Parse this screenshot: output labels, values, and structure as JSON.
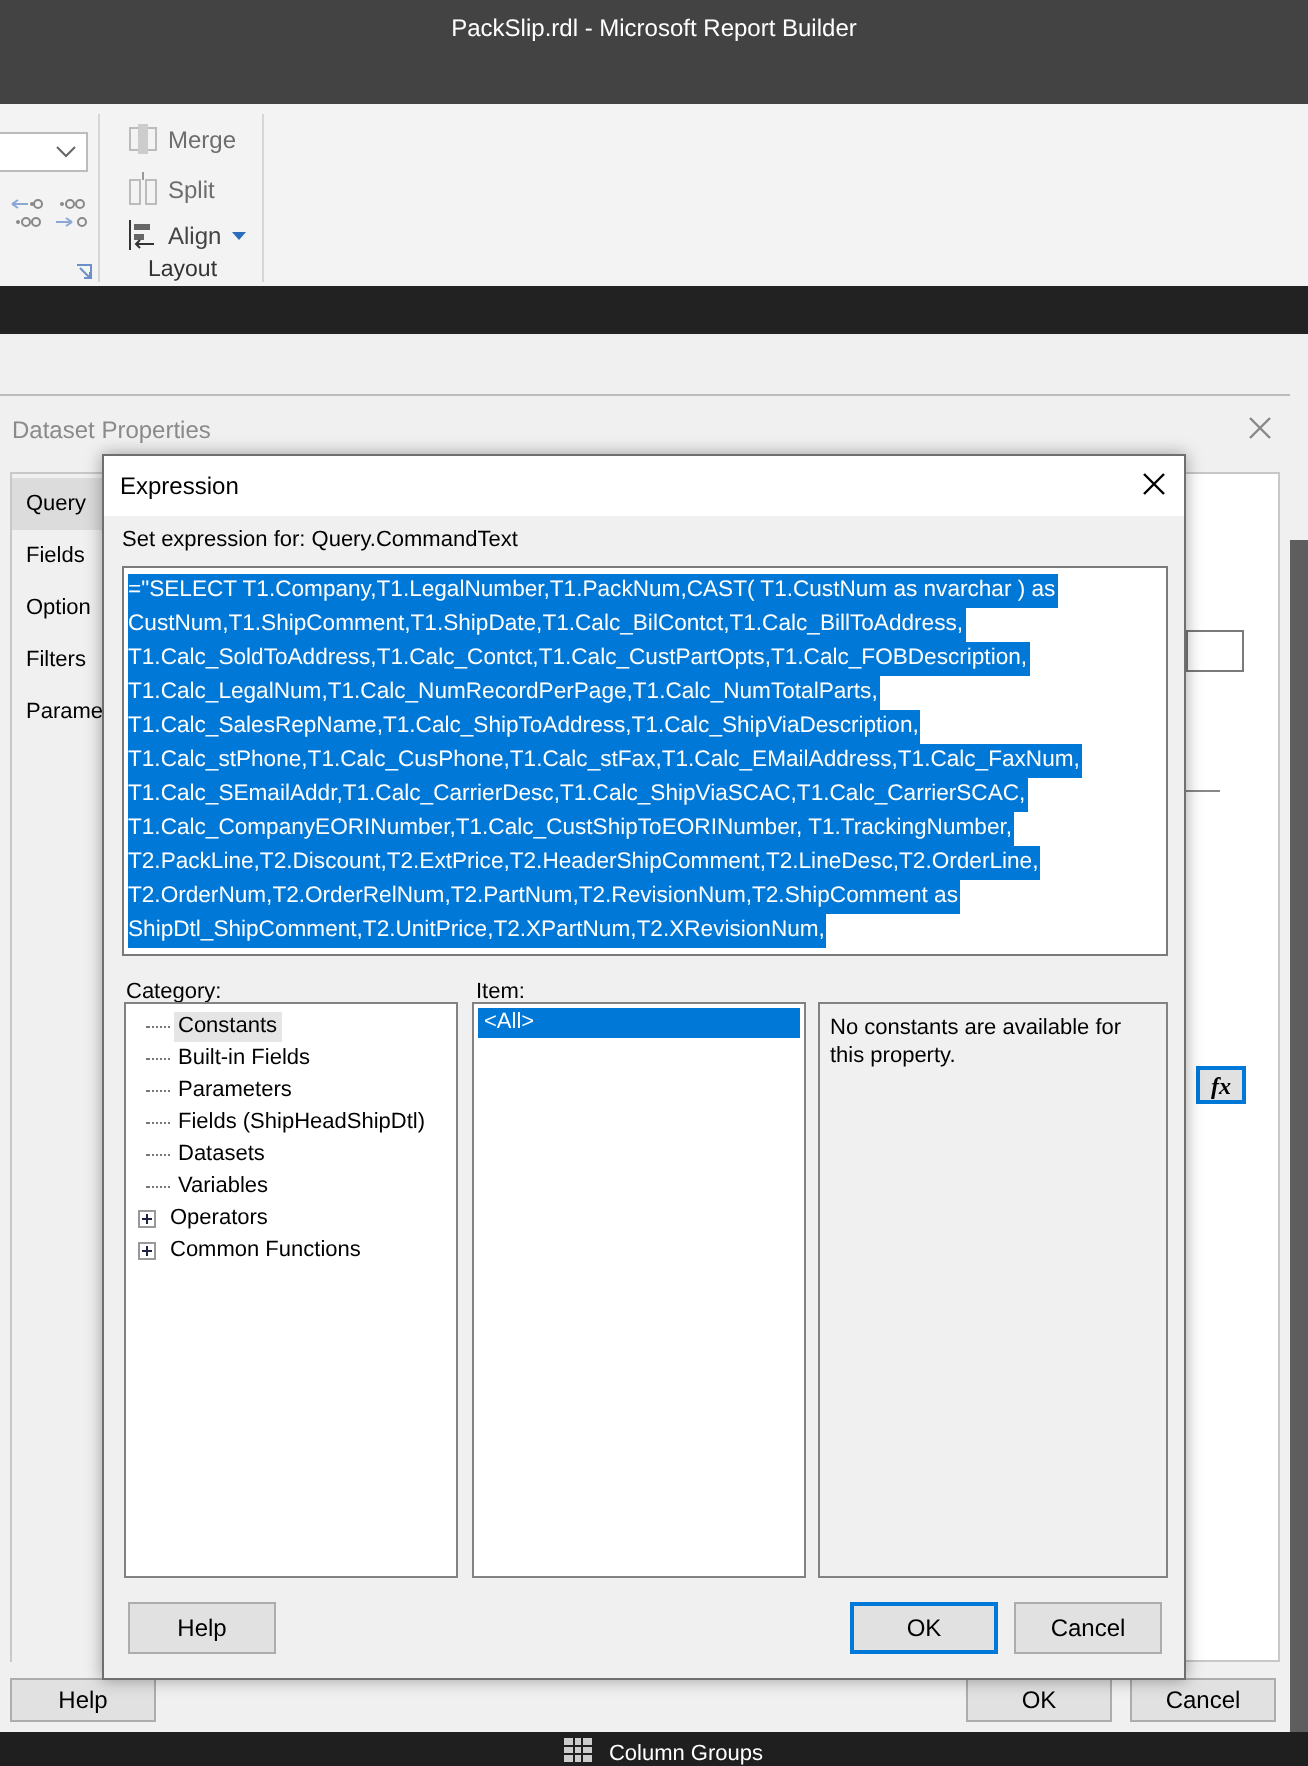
{
  "window": {
    "title": "PackSlip.rdl - Microsoft Report Builder"
  },
  "ribbon": {
    "buttons": [
      {
        "label": "Merge",
        "kind": "merge",
        "disabled": true
      },
      {
        "label": "Split",
        "kind": "split",
        "disabled": true
      },
      {
        "label": "Align",
        "kind": "align",
        "disabled": false
      }
    ],
    "group_label": "Layout"
  },
  "dataset_properties": {
    "title": "Dataset Properties",
    "nav": [
      {
        "label": "Query",
        "selected": true
      },
      {
        "label": "Fields",
        "selected": false
      },
      {
        "label": "Option",
        "selected": false
      },
      {
        "label": "Filters",
        "selected": false
      },
      {
        "label": "Parame",
        "selected": false
      }
    ],
    "fx_button": {
      "label": "fx"
    },
    "buttons": [
      "Help",
      "OK",
      "Cancel"
    ]
  },
  "expression_dialog": {
    "title": "Expression",
    "prompt": "Set expression for: Query.CommandText",
    "expression_lines": [
      "=\"SELECT T1.Company,T1.LegalNumber,T1.PackNum,CAST( T1.CustNum as nvarchar ) as",
      "CustNum,T1.ShipComment,T1.ShipDate,T1.Calc_BilContct,T1.Calc_BillToAddress,",
      "T1.Calc_SoldToAddress,T1.Calc_Contct,T1.Calc_CustPartOpts,T1.Calc_FOBDescription,",
      "T1.Calc_LegalNum,T1.Calc_NumRecordPerPage,T1.Calc_NumTotalParts,",
      "T1.Calc_SalesRepName,T1.Calc_ShipToAddress,T1.Calc_ShipViaDescription,",
      "T1.Calc_stPhone,T1.Calc_CusPhone,T1.Calc_stFax,T1.Calc_EMailAddress,T1.Calc_FaxNum,",
      "T1.Calc_SEmailAddr,T1.Calc_CarrierDesc,T1.Calc_ShipViaSCAC,T1.Calc_CarrierSCAC,",
      "T1.Calc_CompanyEORINumber,T1.Calc_CustShipToEORINumber, T1.TrackingNumber,",
      "T2.PackLine,T2.Discount,T2.ExtPrice,T2.HeaderShipComment,T2.LineDesc,T2.OrderLine,",
      "T2.OrderNum,T2.OrderRelNum,T2.PartNum,T2.RevisionNum,T2.ShipComment as",
      "ShipDtl_ShipComment,T2.UnitPrice,T2.XPartNum,T2.XRevisionNum,"
    ],
    "category_label": "Category:",
    "categories": [
      {
        "label": "Constants",
        "selected": true,
        "expandable": false
      },
      {
        "label": "Built-in Fields",
        "selected": false,
        "expandable": false
      },
      {
        "label": "Parameters",
        "selected": false,
        "expandable": false
      },
      {
        "label": "Fields (ShipHeadShipDtl)",
        "selected": false,
        "expandable": false
      },
      {
        "label": "Datasets",
        "selected": false,
        "expandable": false
      },
      {
        "label": "Variables",
        "selected": false,
        "expandable": false
      },
      {
        "label": "Operators",
        "selected": false,
        "expandable": true
      },
      {
        "label": "Common Functions",
        "selected": false,
        "expandable": true
      }
    ],
    "item_label": "Item:",
    "items": [
      {
        "label": "<All>",
        "selected": true
      }
    ],
    "description": "No constants are available for this property.",
    "buttons": [
      {
        "label": "Help",
        "default": false
      },
      {
        "label": "OK",
        "default": true
      },
      {
        "label": "Cancel",
        "default": false
      }
    ]
  },
  "status_bar": {
    "label": "Column Groups"
  }
}
